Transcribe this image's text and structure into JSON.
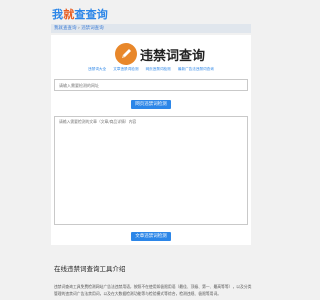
{
  "logo": {
    "part1": "我",
    "part2": "就",
    "part3": "查查询"
  },
  "breadcrumb": {
    "home": "我就查查询",
    "separator": "›",
    "current": "违禁词查询"
  },
  "tool": {
    "title": "违禁词查询",
    "feature_links": [
      "违禁词大全",
      "文章违禁词检测",
      "网页违禁词检测",
      "最新广告法违禁词查询"
    ],
    "url_placeholder": "请输入需要检测的网址",
    "url_button": "网页违禁词检测",
    "text_placeholder": "请输入需要检测的文章（文章/商品详情）内容",
    "text_button": "文章违禁词检测"
  },
  "intro": {
    "title": "在线违禁词查询工具介绍",
    "text": "违禁词查询工具免费检测网站广告法违禁用语，按照不在使用如极限用语（最佳、顶级、第一、最高等等），以及分类管理的违禁词广告法禁用词，以及在大数据检测功能等与检验模式等综合，检测违规、极限等用词。"
  },
  "colors": {
    "accent": "#2c86e8",
    "logo_orange": "#e85e23",
    "icon_orange": "#e8872a"
  }
}
